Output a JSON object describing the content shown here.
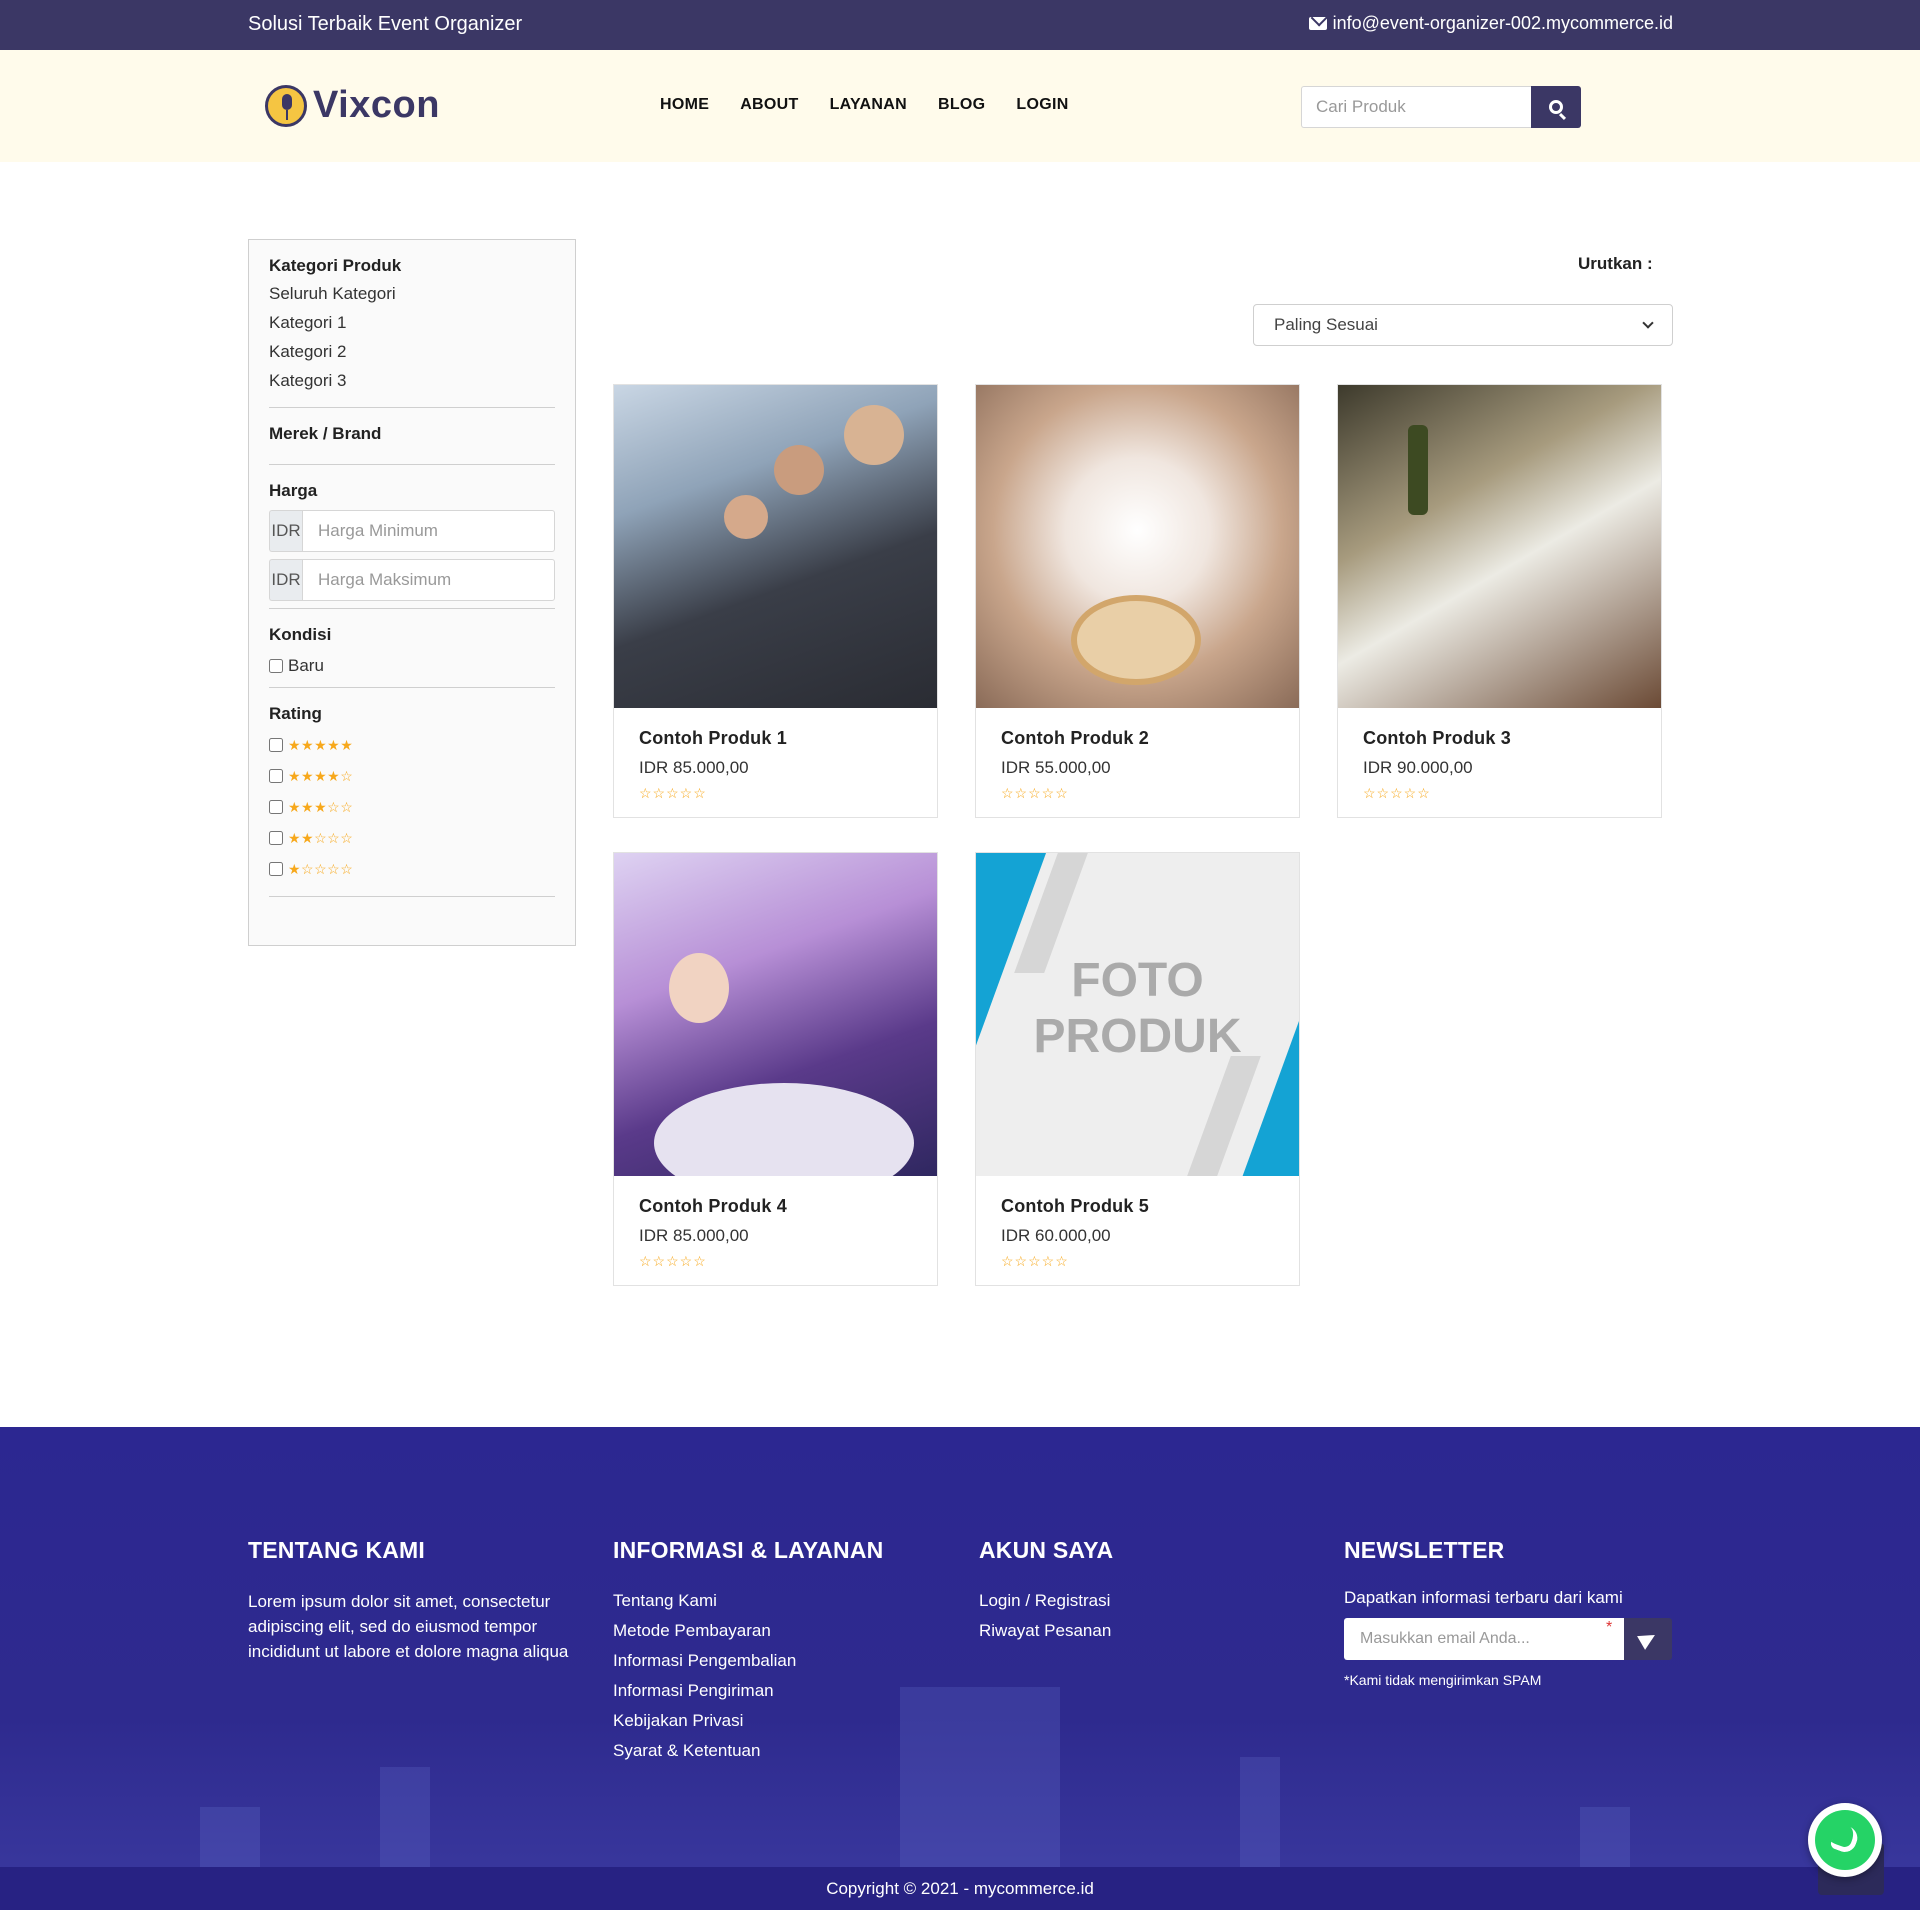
{
  "topbar": {
    "tagline": "Solusi Terbaik Event Organizer",
    "email": "info@event-organizer-002.mycommerce.id",
    "email_icon": "envelope-icon"
  },
  "header": {
    "logo_text": "Vixcon",
    "logo_icon": "microphone-icon",
    "nav": [
      "HOME",
      "ABOUT",
      "LAYANAN",
      "BLOG",
      "LOGIN"
    ],
    "search_placeholder": "Cari Produk",
    "search_icon": "search-icon"
  },
  "sidebar": {
    "category_title": "Kategori Produk",
    "categories": [
      "Seluruh Kategori",
      "Kategori 1",
      "Kategori 2",
      "Kategori 3"
    ],
    "brand_title": "Merek / Brand",
    "price_title": "Harga",
    "currency": "IDR",
    "price_min_placeholder": "Harga Minimum",
    "price_max_placeholder": "Harga Maksimum",
    "condition_title": "Kondisi",
    "condition_new": "Baru",
    "rating_title": "Rating",
    "rating_options": [
      "★★★★★",
      "★★★★☆",
      "★★★☆☆",
      "★★☆☆☆",
      "★☆☆☆☆"
    ]
  },
  "sort": {
    "label": "Urutkan :",
    "selected": "Paling Sesuai"
  },
  "products": [
    {
      "name": "Contoh Produk 1",
      "price": "IDR 85.000,00",
      "rating": "☆☆☆☆☆"
    },
    {
      "name": "Contoh Produk 2",
      "price": "IDR 55.000,00",
      "rating": "☆☆☆☆☆"
    },
    {
      "name": "Contoh Produk 3",
      "price": "IDR 90.000,00",
      "rating": "☆☆☆☆☆"
    },
    {
      "name": "Contoh Produk 4",
      "price": "IDR 85.000,00",
      "rating": "☆☆☆☆☆"
    },
    {
      "name": "Contoh Produk 5",
      "price": "IDR 60.000,00",
      "rating": "☆☆☆☆☆",
      "placeholder_line1": "FOTO",
      "placeholder_line2": "PRODUK"
    }
  ],
  "footer": {
    "about_title": "TENTANG KAMI",
    "about_text": "Lorem ipsum dolor sit amet, consectetur adipiscing elit, sed do eiusmod tempor incididunt ut labore et dolore magna aliqua",
    "info_title": "INFORMASI & LAYANAN",
    "info_links": [
      "Tentang Kami",
      "Metode Pembayaran",
      "Informasi Pengembalian",
      "Informasi Pengiriman",
      "Kebijakan Privasi",
      "Syarat & Ketentuan"
    ],
    "account_title": "AKUN SAYA",
    "account_links": [
      "Login / Registrasi",
      "Riwayat Pesanan"
    ],
    "newsletter_title": "NEWSLETTER",
    "newsletter_text": "Dapatkan informasi terbaru dari kami",
    "newsletter_placeholder": "Masukkan email Anda...",
    "newsletter_required": "*",
    "newsletter_note": "*Kami tidak mengirimkan SPAM",
    "copyright": "Copyright © 2021 - mycommerce.id"
  },
  "colors": {
    "primary": "#3b3765",
    "header_bg": "#fffbeb",
    "footer_bg": "#2c2791",
    "star": "#f7a81b",
    "whatsapp": "#25d366"
  }
}
